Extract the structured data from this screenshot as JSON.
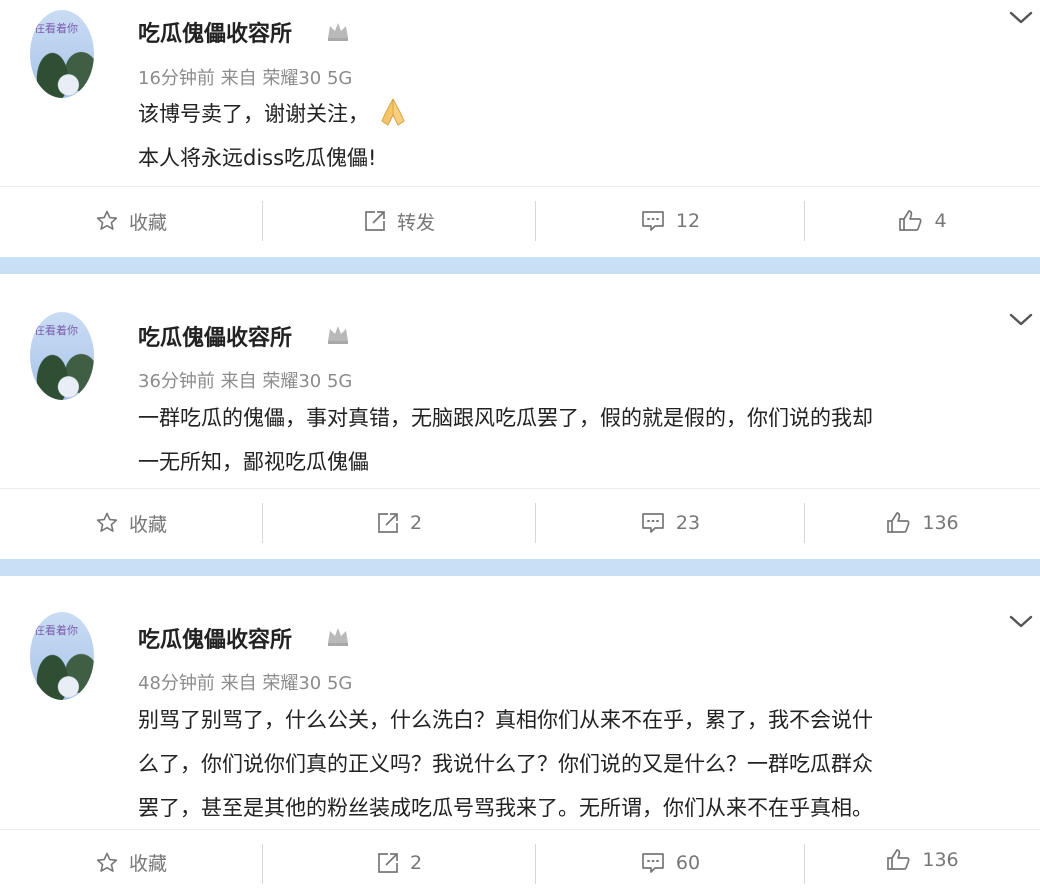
{
  "posts": [
    {
      "author": "吃瓜傀儡收容所",
      "avatar_text": "在看着你",
      "meta": "16分钟前 来自 荣耀30 5G",
      "content_lines": [
        "该博号卖了，谢谢关注，",
        "本人将永远diss吃瓜傀儡!"
      ],
      "emoji_icon": "pray-hands-icon",
      "actions": {
        "favorite_label": "收藏",
        "repost_label": "转发",
        "comments": "12",
        "likes": "4"
      }
    },
    {
      "author": "吃瓜傀儡收容所",
      "avatar_text": "在看着你",
      "meta": "36分钟前 来自 荣耀30 5G",
      "content_lines": [
        "一群吃瓜的傀儡，事对真错，无脑跟风吃瓜罢了，假的就是假的，你们说的我却",
        "一无所知，鄙视吃瓜傀儡"
      ],
      "actions": {
        "favorite_label": "收藏",
        "repost_label": "2",
        "comments": "23",
        "likes": "136"
      }
    },
    {
      "author": "吃瓜傀儡收容所",
      "avatar_text": "在看着你",
      "meta": "48分钟前 来自 荣耀30 5G",
      "content_lines": [
        "别骂了别骂了，什么公关，什么洗白？真相你们从来不在乎，累了，我不会说什",
        "么了，你们说你们真的正义吗？我说什么了？你们说的又是什么？一群吃瓜群众",
        "罢了，甚至是其他的粉丝装成吃瓜号骂我来了。无所谓，你们从来不在乎真相。"
      ],
      "actions": {
        "favorite_label": "收藏",
        "repost_label": "2",
        "comments": "60",
        "likes": "136"
      }
    }
  ],
  "colors": {
    "divider": "#c8e0f6",
    "meta_text": "#8c8c8c",
    "action_text": "#777777"
  }
}
